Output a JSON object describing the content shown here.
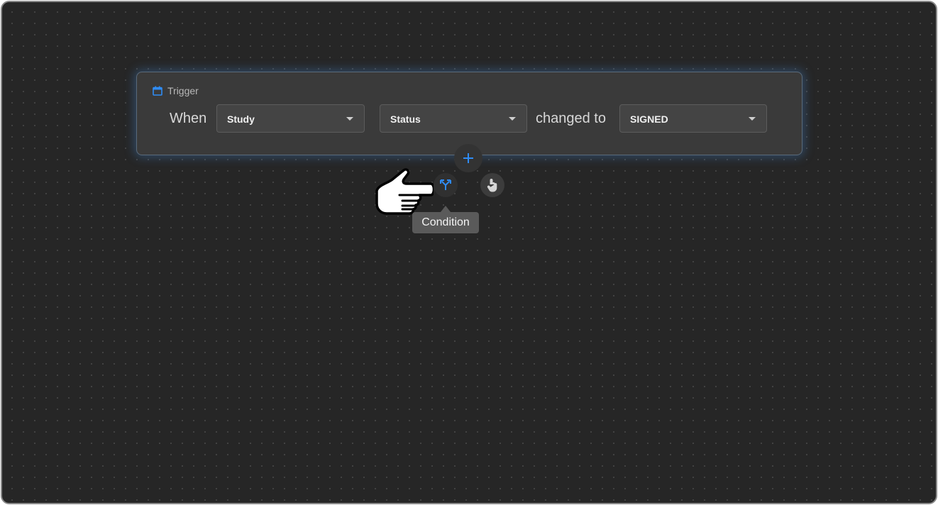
{
  "trigger": {
    "header_label": "Trigger",
    "icon": "calendar-icon",
    "when_label": "When",
    "entity_select": {
      "value": "Study"
    },
    "field_select": {
      "value": "Status"
    },
    "changed_to_label": "changed to",
    "value_select": {
      "value": "SIGNED"
    }
  },
  "toolbar": {
    "add_icon": "plus-icon",
    "condition_icon": "branch-icon",
    "action_icon": "touch-hand-icon",
    "tooltip": "Condition"
  },
  "colors": {
    "canvas": "#262626",
    "card": "#3a3a3a",
    "accent": "#2f8cf5",
    "tooltip": "#5a5a5a"
  }
}
